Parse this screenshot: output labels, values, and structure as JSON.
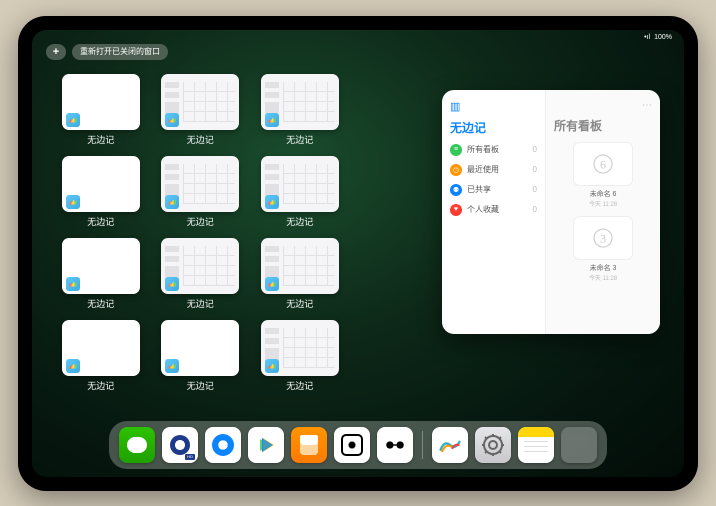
{
  "status": {
    "signal": "•ıl",
    "battery": "100%"
  },
  "topbar": {
    "plus": "+",
    "reopen_label": "重新打开已关闭的窗口"
  },
  "app_name": "无边记",
  "windows": [
    {
      "type": "blank",
      "label": "无边记"
    },
    {
      "type": "content",
      "label": "无边记"
    },
    {
      "type": "content",
      "label": "无边记"
    },
    {
      "type": "blank",
      "label": "无边记"
    },
    {
      "type": "content",
      "label": "无边记"
    },
    {
      "type": "content",
      "label": "无边记"
    },
    {
      "type": "blank",
      "label": "无边记"
    },
    {
      "type": "content",
      "label": "无边记"
    },
    {
      "type": "content",
      "label": "无边记"
    },
    {
      "type": "blank",
      "label": "无边记"
    },
    {
      "type": "blank",
      "label": "无边记"
    },
    {
      "type": "content",
      "label": "无边记"
    }
  ],
  "grid_layout": [
    [
      0,
      1,
      2,
      null
    ],
    [
      3,
      4,
      5,
      null
    ],
    [
      6,
      7,
      8,
      null
    ],
    [
      9,
      10,
      11,
      null
    ]
  ],
  "overlay": {
    "left_title": "无边记",
    "right_title": "所有看板",
    "items": [
      {
        "icon": "list",
        "color": "#34c759",
        "label": "所有看板",
        "count": "0"
      },
      {
        "icon": "clock",
        "color": "#ff9500",
        "label": "最近使用",
        "count": "0"
      },
      {
        "icon": "people",
        "color": "#0a84ff",
        "label": "已共享",
        "count": "0"
      },
      {
        "icon": "heart",
        "color": "#ff3b30",
        "label": "个人收藏",
        "count": "0"
      }
    ],
    "boards": [
      {
        "digit": "6",
        "label": "未命名 6",
        "sub": "今天 11:28"
      },
      {
        "digit": "3",
        "label": "未命名 3",
        "sub": "今天 11:28"
      }
    ]
  },
  "dock": {
    "apps": [
      {
        "name": "wechat"
      },
      {
        "name": "quark",
        "badge": "HD"
      },
      {
        "name": "browser"
      },
      {
        "name": "video"
      },
      {
        "name": "books"
      },
      {
        "name": "dots"
      },
      {
        "name": "assist"
      }
    ],
    "recents": [
      {
        "name": "freeform"
      },
      {
        "name": "settings"
      },
      {
        "name": "notes"
      },
      {
        "name": "folder"
      }
    ]
  }
}
